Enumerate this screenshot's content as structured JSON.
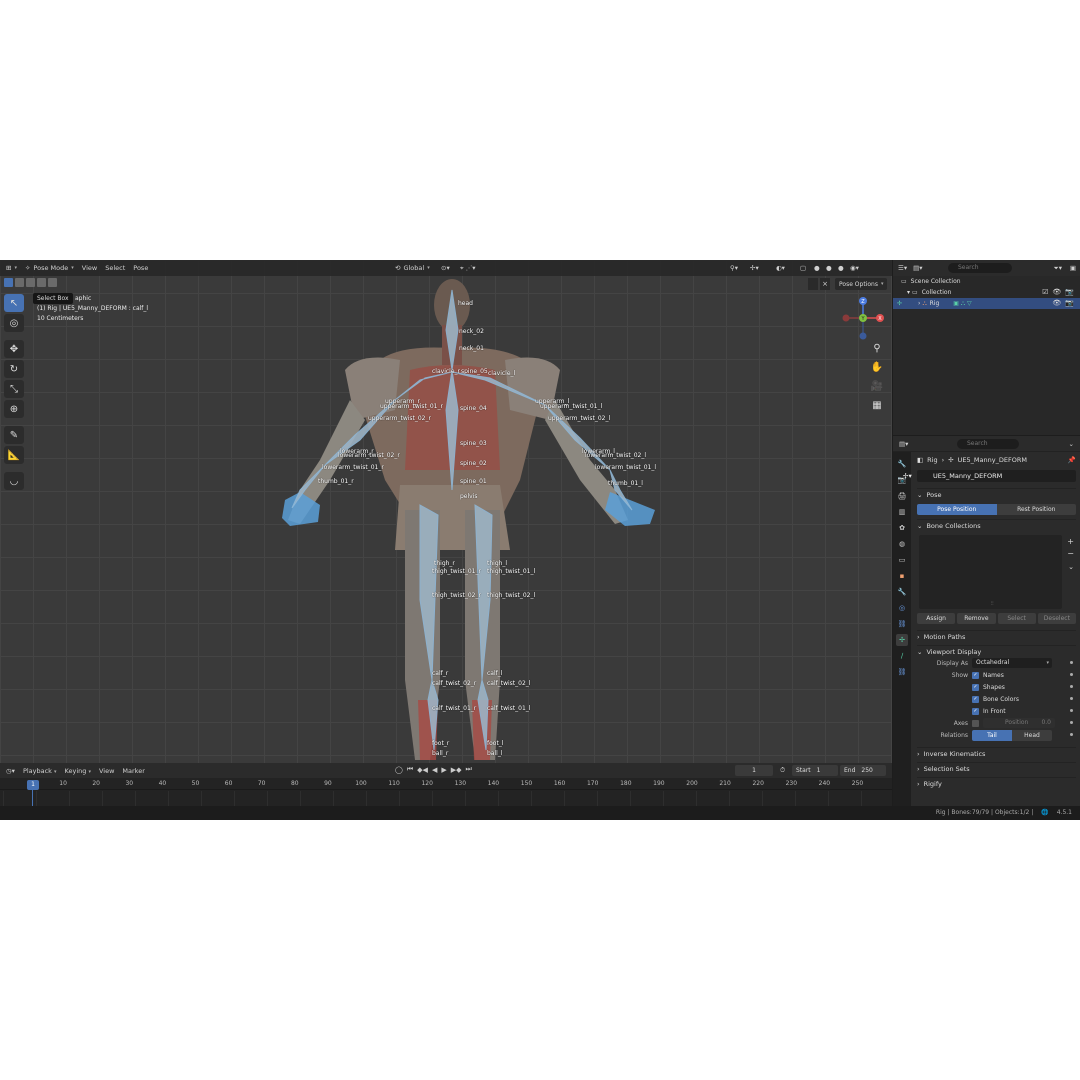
{
  "viewport": {
    "mode": "Pose Mode",
    "menus": [
      "View",
      "Select",
      "Pose"
    ],
    "transform_orientation": "Global",
    "tooltip": "Select Box",
    "overlay_lines": [
      "aphic",
      "(1) Rig | UE5_Manny_DEFORM : calf_l",
      "10 Centimeters"
    ],
    "pose_options": "Pose Options",
    "gizmo": {
      "x": "X",
      "y": "Y",
      "z": "Z"
    }
  },
  "bones": [
    {
      "label": "head"
    },
    {
      "label": "neck_02"
    },
    {
      "label": "neck_01"
    },
    {
      "label": "clavicle_r"
    },
    {
      "label": "clavicle_l"
    },
    {
      "label": "spine_05"
    },
    {
      "label": "upperarm_r"
    },
    {
      "label": "upperarm_l"
    },
    {
      "label": "upperarm_twist_01_r"
    },
    {
      "label": "upperarm_twist_01_l"
    },
    {
      "label": "upperarm_twist_02_r"
    },
    {
      "label": "upperarm_twist_02_l"
    },
    {
      "label": "spine_04"
    },
    {
      "label": "spine_03"
    },
    {
      "label": "spine_02"
    },
    {
      "label": "spine_01"
    },
    {
      "label": "lowerarm_r"
    },
    {
      "label": "lowerarm_l"
    },
    {
      "label": "lowerarm_twist_02_r"
    },
    {
      "label": "lowerarm_twist_02_l"
    },
    {
      "label": "lowerarm_twist_01_r"
    },
    {
      "label": "lowerarm_twist_01_l"
    },
    {
      "label": "thumb_01_r"
    },
    {
      "label": "thumb_01_l"
    },
    {
      "label": "pelvis"
    },
    {
      "label": "thigh_r"
    },
    {
      "label": "thigh_l"
    },
    {
      "label": "thigh_twist_01_r"
    },
    {
      "label": "thigh_twist_01_l"
    },
    {
      "label": "thigh_twist_02_r"
    },
    {
      "label": "thigh_twist_02_l"
    },
    {
      "label": "calf_r"
    },
    {
      "label": "calf_l"
    },
    {
      "label": "calf_twist_02_r"
    },
    {
      "label": "calf_twist_02_l"
    },
    {
      "label": "calf_twist_01_r"
    },
    {
      "label": "calf_twist_01_l"
    },
    {
      "label": "foot_r"
    },
    {
      "label": "foot_l"
    },
    {
      "label": "ball_r"
    },
    {
      "label": "ball_l"
    }
  ],
  "timeline": {
    "menus": [
      "Playback",
      "Keying",
      "View",
      "Marker"
    ],
    "current_frame": "1",
    "start_label": "Start",
    "start": "1",
    "end_label": "End",
    "end": "250",
    "ruler": [
      "1",
      "10",
      "20",
      "30",
      "40",
      "50",
      "60",
      "70",
      "80",
      "90",
      "100",
      "110",
      "120",
      "130",
      "140",
      "150",
      "160",
      "170",
      "180",
      "190",
      "200",
      "210",
      "220",
      "230",
      "240",
      "250"
    ]
  },
  "outliner": {
    "search_placeholder": "Search",
    "rows": [
      {
        "label": "Scene Collection"
      },
      {
        "label": "Collection"
      },
      {
        "label": "Rig"
      }
    ]
  },
  "properties": {
    "search_placeholder": "Search",
    "breadcrumb_object": "Rig",
    "breadcrumb_data": "UE5_Manny_DEFORM",
    "armature_name": "UE5_Manny_DEFORM",
    "pose_panel": "Pose",
    "pose_position": "Pose Position",
    "rest_position": "Rest Position",
    "bone_collections_panel": "Bone Collections",
    "assign": "Assign",
    "remove": "Remove",
    "select": "Select",
    "deselect": "Deselect",
    "motion_paths": "Motion Paths",
    "viewport_display": "Viewport Display",
    "display_as_label": "Display As",
    "display_as_value": "Octahedral",
    "show_label": "Show",
    "show_names": "Names",
    "show_shapes": "Shapes",
    "show_bone_colors": "Bone Colors",
    "show_in_front": "In Front",
    "axes_label": "Axes",
    "position_label": "Position",
    "position_value": "0.0",
    "relations_label": "Relations",
    "tail": "Tail",
    "head": "Head",
    "inverse_kinematics": "Inverse Kinematics",
    "selection_sets": "Selection Sets",
    "next_panel": "Rigify"
  },
  "status": {
    "info": "Rig | Bones:79/79 | Objects:1/2 |",
    "version": "4.5.1"
  },
  "colors": {
    "accent": "#4772b3",
    "selected_row": "#334d80",
    "bone_tab": "#59d0a7"
  }
}
